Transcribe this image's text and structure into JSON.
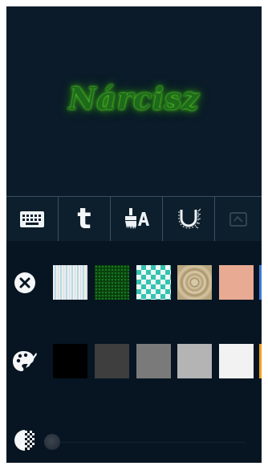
{
  "preview": {
    "text": "Nárcisz"
  },
  "toolbar": {
    "tools": [
      {
        "name": "keyboard-tool",
        "icon": "keyboard-icon"
      },
      {
        "name": "font-tool",
        "icon": "tumblr-t-icon",
        "label": "t"
      },
      {
        "name": "text-color-tool",
        "icon": "paint-brush-letter-a-icon"
      },
      {
        "name": "glow-tool",
        "icon": "glow-effect-icon"
      },
      {
        "name": "more-tool",
        "icon": "faded-tool-icon"
      }
    ]
  },
  "background_row": {
    "icon": "close-circle-icon",
    "swatches": [
      "stripes",
      "green-texture",
      "teal-diamond",
      "tan-marble",
      "salmon"
    ]
  },
  "color_row": {
    "icon": "palette-icon",
    "swatches": [
      "#000000",
      "#3e3e3e",
      "#7a7a7a",
      "#b4b4b4",
      "#f2f2f2"
    ]
  },
  "opacity_row": {
    "icon": "opacity-icon",
    "value": 0.0
  },
  "colors": {
    "screen_bg": "#0b1b29",
    "panel_bg": "#071522",
    "glow_text": "#3fa91d",
    "scroll_hint_blue": "#3f7ad6",
    "scroll_hint_orange": "#f0a020"
  }
}
